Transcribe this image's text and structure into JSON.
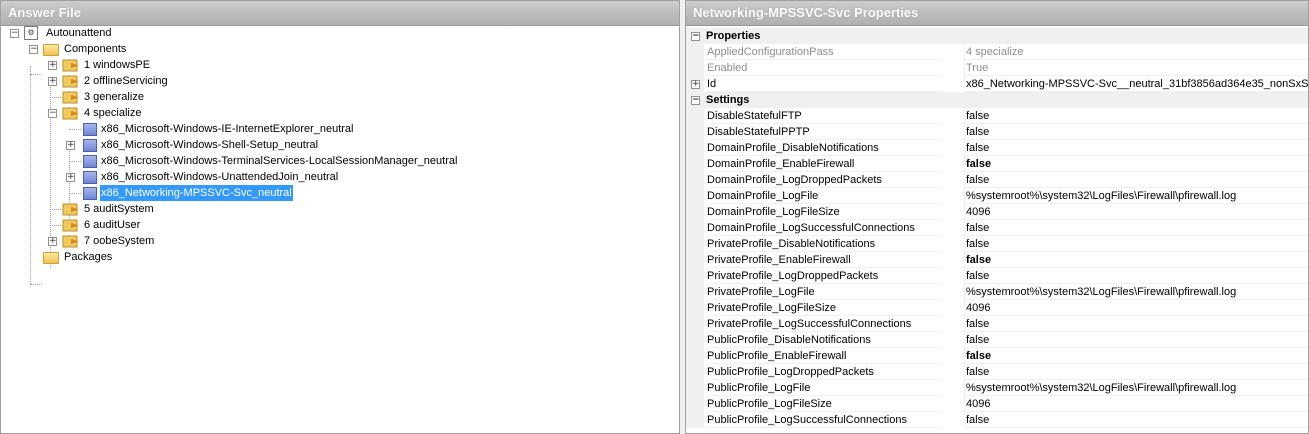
{
  "answer_file": {
    "title": "Answer File",
    "root_label": "Autounattend",
    "components_label": "Components",
    "passes": [
      {
        "label": "1 windowsPE"
      },
      {
        "label": "2 offlineServicing"
      },
      {
        "label": "3 generalize"
      },
      {
        "label": "4 specialize"
      },
      {
        "label": "5 auditSystem"
      },
      {
        "label": "6 auditUser"
      },
      {
        "label": "7 oobeSystem"
      }
    ],
    "specialize_children": [
      {
        "label": "x86_Microsoft-Windows-IE-InternetExplorer_neutral"
      },
      {
        "label": "x86_Microsoft-Windows-Shell-Setup_neutral"
      },
      {
        "label": "x86_Microsoft-Windows-TerminalServices-LocalSessionManager_neutral"
      },
      {
        "label": "x86_Microsoft-Windows-UnattendedJoin_neutral"
      },
      {
        "label": "x86_Networking-MPSSVC-Svc_neutral"
      }
    ],
    "packages_label": "Packages",
    "icons": {
      "root": "answer-file-icon",
      "folder": "folder-icon",
      "pass": "config-pass-icon",
      "component": "component-icon"
    }
  },
  "properties": {
    "title": "Networking-MPSSVC-Svc Properties",
    "categories": {
      "properties": "Properties",
      "settings": "Settings"
    },
    "general": [
      {
        "name": "AppliedConfigurationPass",
        "value": "4 specialize"
      },
      {
        "name": "Enabled",
        "value": "True"
      },
      {
        "name": "Id",
        "value": "x86_Networking-MPSSVC-Svc__neutral_31bf3856ad364e35_nonSxS"
      }
    ],
    "settings": [
      {
        "name": "DisableStatefulFTP",
        "value": "false"
      },
      {
        "name": "DisableStatefulPPTP",
        "value": "false"
      },
      {
        "name": "DomainProfile_DisableNotifications",
        "value": "false"
      },
      {
        "name": "DomainProfile_EnableFirewall",
        "value": "false"
      },
      {
        "name": "DomainProfile_LogDroppedPackets",
        "value": "false"
      },
      {
        "name": "DomainProfile_LogFile",
        "value": "%systemroot%\\system32\\LogFiles\\Firewall\\pfirewall.log"
      },
      {
        "name": "DomainProfile_LogFileSize",
        "value": "4096"
      },
      {
        "name": "DomainProfile_LogSuccessfulConnections",
        "value": "false"
      },
      {
        "name": "PrivateProfile_DisableNotifications",
        "value": "false"
      },
      {
        "name": "PrivateProfile_EnableFirewall",
        "value": "false"
      },
      {
        "name": "PrivateProfile_LogDroppedPackets",
        "value": "false"
      },
      {
        "name": "PrivateProfile_LogFile",
        "value": "%systemroot%\\system32\\LogFiles\\Firewall\\pfirewall.log"
      },
      {
        "name": "PrivateProfile_LogFileSize",
        "value": "4096"
      },
      {
        "name": "PrivateProfile_LogSuccessfulConnections",
        "value": "false"
      },
      {
        "name": "PublicProfile_DisableNotifications",
        "value": "false"
      },
      {
        "name": "PublicProfile_EnableFirewall",
        "value": "false"
      },
      {
        "name": "PublicProfile_LogDroppedPackets",
        "value": "false"
      },
      {
        "name": "PublicProfile_LogFile",
        "value": "%systemroot%\\system32\\LogFiles\\Firewall\\pfirewall.log"
      },
      {
        "name": "PublicProfile_LogFileSize",
        "value": "4096"
      },
      {
        "name": "PublicProfile_LogSuccessfulConnections",
        "value": "false"
      }
    ],
    "colors": {
      "selection": "#3399ff",
      "readonly_text": "#8e8e8e",
      "header_gradient": "#bababa"
    }
  }
}
